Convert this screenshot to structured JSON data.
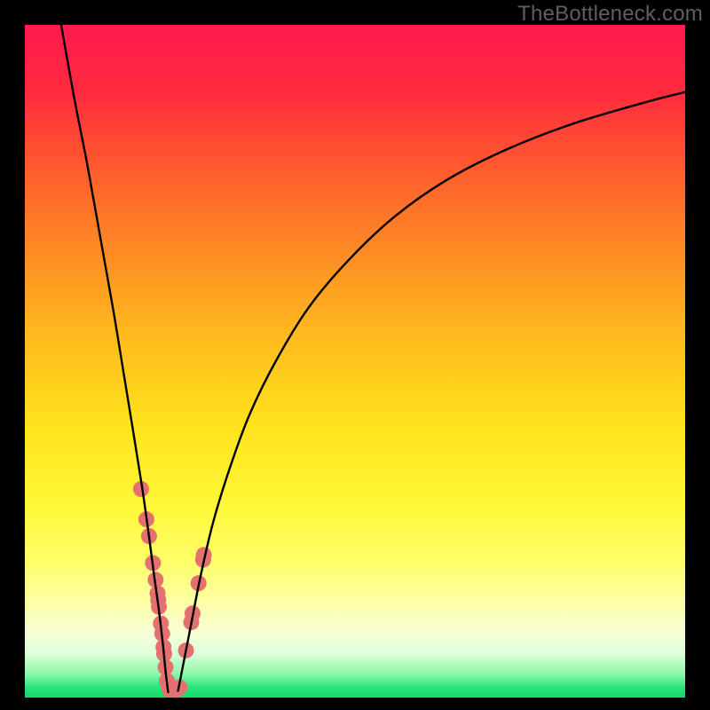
{
  "watermark": "TheBottleneck.com",
  "chart_data": {
    "type": "line",
    "title": "",
    "xlabel": "",
    "ylabel": "",
    "xlim": [
      0,
      100
    ],
    "ylim": [
      0,
      100
    ],
    "gradient_stops": [
      {
        "offset": 0.0,
        "color": "#ff1a4f"
      },
      {
        "offset": 0.1,
        "color": "#ff2b3e"
      },
      {
        "offset": 0.25,
        "color": "#ff6a2a"
      },
      {
        "offset": 0.45,
        "color": "#ffb61f"
      },
      {
        "offset": 0.6,
        "color": "#ffe41c"
      },
      {
        "offset": 0.72,
        "color": "#fff83a"
      },
      {
        "offset": 0.8,
        "color": "#ffff6a"
      },
      {
        "offset": 0.86,
        "color": "#fdffa8"
      },
      {
        "offset": 0.905,
        "color": "#f7ffd8"
      },
      {
        "offset": 0.935,
        "color": "#dcffd9"
      },
      {
        "offset": 0.965,
        "color": "#8cf7a8"
      },
      {
        "offset": 0.985,
        "color": "#29e37a"
      },
      {
        "offset": 1.0,
        "color": "#16d968"
      }
    ],
    "series": [
      {
        "name": "left-branch",
        "x": [
          5.5,
          7.5,
          9.5,
          11.5,
          13.5,
          15.0,
          16.5,
          17.8,
          18.8,
          19.6,
          20.3,
          20.9,
          21.3,
          21.7
        ],
        "y": [
          100,
          89,
          79,
          68,
          57,
          48,
          39,
          31,
          24,
          18,
          13,
          8,
          4,
          0.8
        ]
      },
      {
        "name": "right-branch",
        "x": [
          23.2,
          24.0,
          25.2,
          26.6,
          28.5,
          31.0,
          34.0,
          38.0,
          43.0,
          49.0,
          56.0,
          64.0,
          73.0,
          83.0,
          94.0,
          100.0
        ],
        "y": [
          1.0,
          5.0,
          11.0,
          18.0,
          26.0,
          34.0,
          42.0,
          50.0,
          58.0,
          65.0,
          71.5,
          77.0,
          81.5,
          85.3,
          88.5,
          90.0
        ]
      }
    ],
    "scatter": {
      "name": "highlight-points",
      "color": "#e4716f",
      "radius": 9,
      "points": [
        {
          "x": 17.6,
          "y": 31.0
        },
        {
          "x": 18.4,
          "y": 26.5
        },
        {
          "x": 18.8,
          "y": 24.0
        },
        {
          "x": 19.4,
          "y": 20.0
        },
        {
          "x": 19.8,
          "y": 17.5
        },
        {
          "x": 20.1,
          "y": 15.5
        },
        {
          "x": 20.2,
          "y": 14.5
        },
        {
          "x": 20.3,
          "y": 13.5
        },
        {
          "x": 20.6,
          "y": 11.0
        },
        {
          "x": 20.8,
          "y": 9.5
        },
        {
          "x": 21.0,
          "y": 7.5
        },
        {
          "x": 21.1,
          "y": 6.5
        },
        {
          "x": 21.3,
          "y": 4.5
        },
        {
          "x": 21.5,
          "y": 2.5
        },
        {
          "x": 21.9,
          "y": 1.2
        },
        {
          "x": 22.3,
          "y": 1.0
        },
        {
          "x": 22.7,
          "y": 1.0
        },
        {
          "x": 23.4,
          "y": 1.5
        },
        {
          "x": 24.4,
          "y": 7.0
        },
        {
          "x": 25.2,
          "y": 11.2
        },
        {
          "x": 25.4,
          "y": 12.5
        },
        {
          "x": 26.3,
          "y": 17.0
        },
        {
          "x": 27.0,
          "y": 20.5
        },
        {
          "x": 27.1,
          "y": 21.2
        }
      ]
    }
  }
}
